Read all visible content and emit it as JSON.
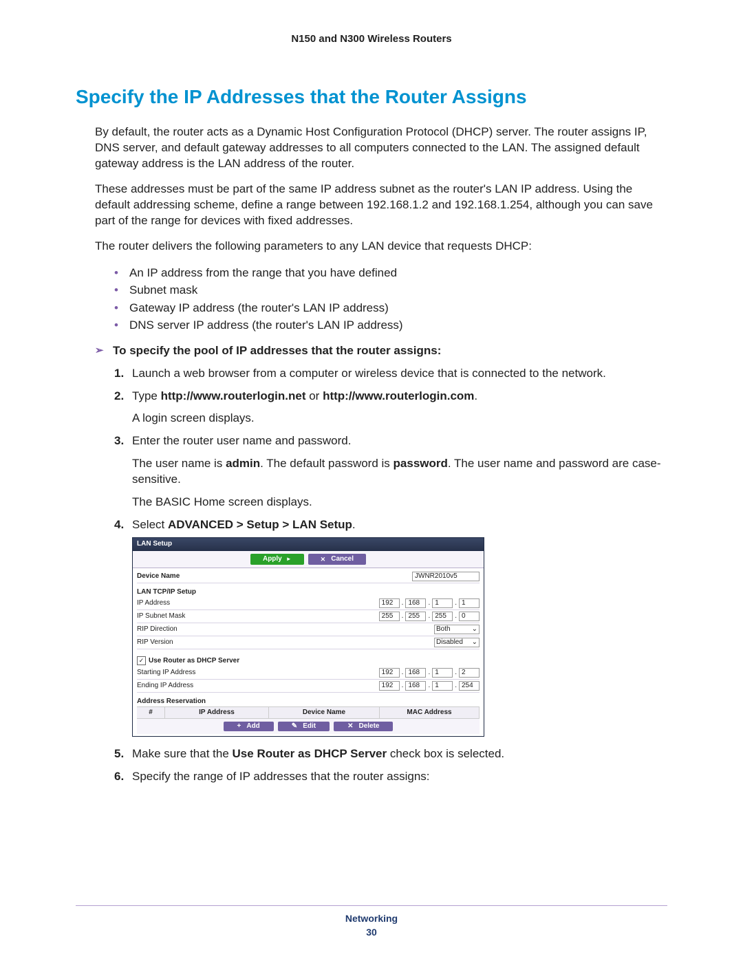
{
  "header": {
    "title": "N150 and N300 Wireless Routers"
  },
  "heading": "Specify the IP Addresses that the Router Assigns",
  "para1": "By default, the router acts as a Dynamic Host Configuration Protocol (DHCP) server. The router assigns IP, DNS server, and default gateway addresses to all computers connected to the LAN. The assigned default gateway address is the LAN address of the router.",
  "para2": "These addresses must be part of the same IP address subnet as the router's LAN IP address. Using the default addressing scheme, define a range between 192.168.1.2 and 192.168.1.254, although you can save part of the range for devices with fixed addresses.",
  "para3": "The router delivers the following parameters to any LAN device that requests DHCP:",
  "bullets": [
    "An IP address from the range that you have defined",
    "Subnet mask",
    "Gateway IP address (the router's LAN IP address)",
    "DNS server IP address (the router's LAN IP address)"
  ],
  "procedure_lead": "To specify the pool of IP addresses that the router assigns:",
  "steps": {
    "s1": "Launch a web browser from a computer or wireless device that is connected to the network.",
    "s2_pre": "Type ",
    "s2_bold": "http://www.routerlogin.net",
    "s2_mid": " or ",
    "s2_bold2": "http://www.routerlogin.com",
    "s2_post": ".",
    "s2_sub": "A login screen displays.",
    "s3": "Enter the router user name and password.",
    "s3_sub_pre": "The user name is ",
    "s3_sub_b1": "admin",
    "s3_sub_mid": ". The default password is ",
    "s3_sub_b2": "password",
    "s3_sub_post": ". The user name and password are case-sensitive.",
    "s3_sub2": "The BASIC Home screen displays.",
    "s4_pre": "Select ",
    "s4_bold": "ADVANCED > Setup > LAN Setup",
    "s4_post": ".",
    "s5_pre": "Make sure that the ",
    "s5_bold": "Use Router as DHCP Server",
    "s5_post": " check box is selected.",
    "s6": "Specify the range of IP addresses that the router assigns:"
  },
  "ui": {
    "title": "LAN Setup",
    "apply": "Apply",
    "cancel": "Cancel",
    "device_name_label": "Device Name",
    "device_name_value": "JWNR2010v5",
    "lan_section": "LAN TCP/IP Setup",
    "ip_address_label": "IP Address",
    "ip_address": [
      "192",
      "168",
      "1",
      "1"
    ],
    "subnet_label": "IP Subnet Mask",
    "subnet": [
      "255",
      "255",
      "255",
      "0"
    ],
    "rip_dir_label": "RIP Direction",
    "rip_dir_value": "Both",
    "rip_ver_label": "RIP Version",
    "rip_ver_value": "Disabled",
    "dhcp_check_label": "Use Router as DHCP Server",
    "start_ip_label": "Starting IP Address",
    "start_ip": [
      "192",
      "168",
      "1",
      "2"
    ],
    "end_ip_label": "Ending IP Address",
    "end_ip": [
      "192",
      "168",
      "1",
      "254"
    ],
    "addr_res_label": "Address Reservation",
    "th_hash": "#",
    "th_ip": "IP Address",
    "th_dev": "Device Name",
    "th_mac": "MAC Address",
    "add": "Add",
    "edit": "Edit",
    "delete": "Delete"
  },
  "footer": {
    "section": "Networking",
    "page": "30"
  }
}
